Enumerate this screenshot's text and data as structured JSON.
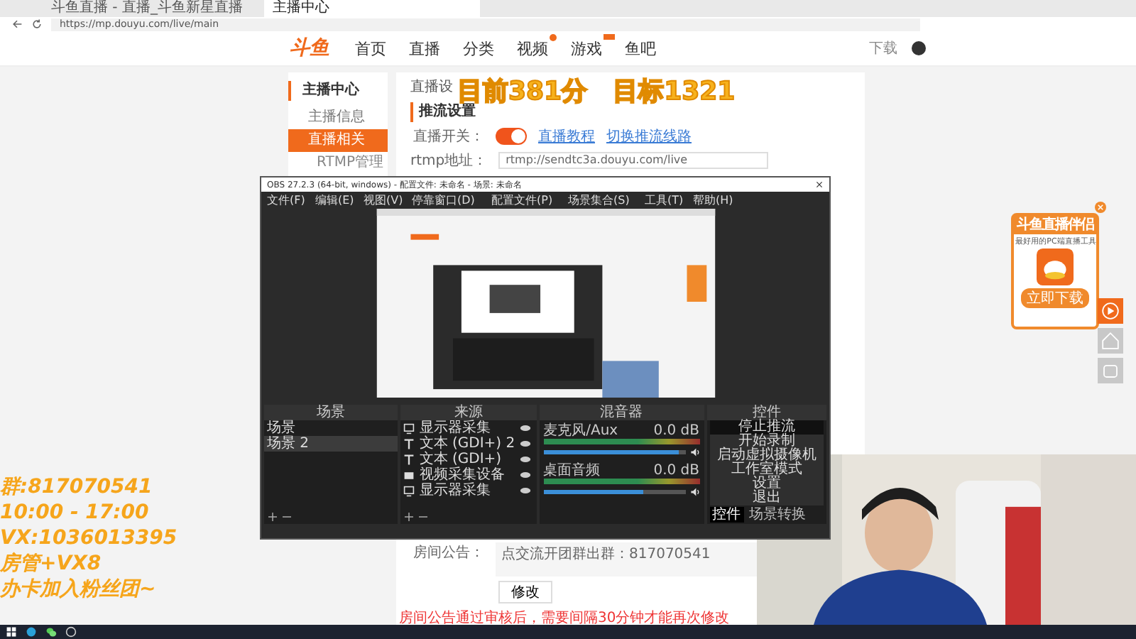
{
  "browser": {
    "tabs": [
      {
        "title": "斗鱼直播 - 直播_斗鱼新星直播",
        "selected": false
      },
      {
        "title": "主播中心",
        "selected": true
      }
    ],
    "url": "https://mp.douyu.com/live/main"
  },
  "site": {
    "logo": "斗鱼",
    "nav": [
      {
        "label": "首页"
      },
      {
        "label": "直播"
      },
      {
        "label": "分类"
      },
      {
        "label": "视频",
        "dot": true
      },
      {
        "label": "游戏",
        "tag": true
      },
      {
        "label": "鱼吧"
      }
    ],
    "download": "下载"
  },
  "sidebar": {
    "title": "主播中心",
    "items": [
      {
        "label": "主播信息",
        "selected": false
      },
      {
        "label": "直播相关",
        "selected": true
      }
    ],
    "subitem": "RTMP管理"
  },
  "main": {
    "title": "直播设",
    "section": "推流设置",
    "switch_label": "直播开关：",
    "switch_on": true,
    "links": [
      "直播教程",
      "切换推流线路"
    ],
    "rtmp_label": "rtmp地址：",
    "rtmp_value": "rtmp://sendtc3a.douyu.com/live",
    "notice_label": "房间公告：",
    "notice_text": "点交流开团群出群：817070541",
    "edit_button": "修改",
    "note": "房间公告通过审核后，需要间隔30分钟才能再次修改"
  },
  "overlay": {
    "score": "目前381分　目标1321",
    "lines": [
      "群:817070541",
      "10:00 - 17:00",
      "VX:1036013395",
      "房管+VX8",
      "办卡加入粉丝团~"
    ]
  },
  "ad": {
    "title": "斗鱼直播伴侣",
    "subtitle": "最好用的PC端直播工具",
    "button": "立即下载"
  },
  "obs": {
    "title": "OBS 27.2.3 (64-bit, windows) - 配置文件: 未命名 - 场景: 未命名",
    "menu": [
      "文件(F)",
      "编辑(E)",
      "视图(V)",
      "停靠窗口(D)",
      "配置文件(P)",
      "场景集合(S)",
      "工具(T)",
      "帮助(H)"
    ],
    "docks": [
      "场景",
      "来源",
      "混音器",
      "控件"
    ],
    "scenes": [
      {
        "name": "场景",
        "selected": false
      },
      {
        "name": "场景 2",
        "selected": true
      }
    ],
    "sources": [
      {
        "name": "显示器采集",
        "kind": "monitor"
      },
      {
        "name": "文本 (GDI+) 2",
        "kind": "text"
      },
      {
        "name": "文本 (GDI+)",
        "kind": "text"
      },
      {
        "name": "视频采集设备",
        "kind": "camera"
      },
      {
        "name": "显示器采集",
        "kind": "monitor"
      }
    ],
    "mixer": [
      {
        "name": "麦克风/Aux",
        "reading": "0.0 dB",
        "level": 0.95
      },
      {
        "name": "桌面音频",
        "reading": "0.0 dB",
        "level": 0.7
      }
    ],
    "controls": [
      {
        "label": "停止推流",
        "selected": true
      },
      {
        "label": "开始录制",
        "selected": false
      },
      {
        "label": "启动虚拟摄像机",
        "selected": false
      },
      {
        "label": "工作室模式",
        "selected": false
      },
      {
        "label": "设置",
        "selected": false
      },
      {
        "label": "退出",
        "selected": false
      }
    ],
    "control_tabs": [
      {
        "label": "控件",
        "selected": true
      },
      {
        "label": "场景转换",
        "selected": false
      }
    ]
  }
}
